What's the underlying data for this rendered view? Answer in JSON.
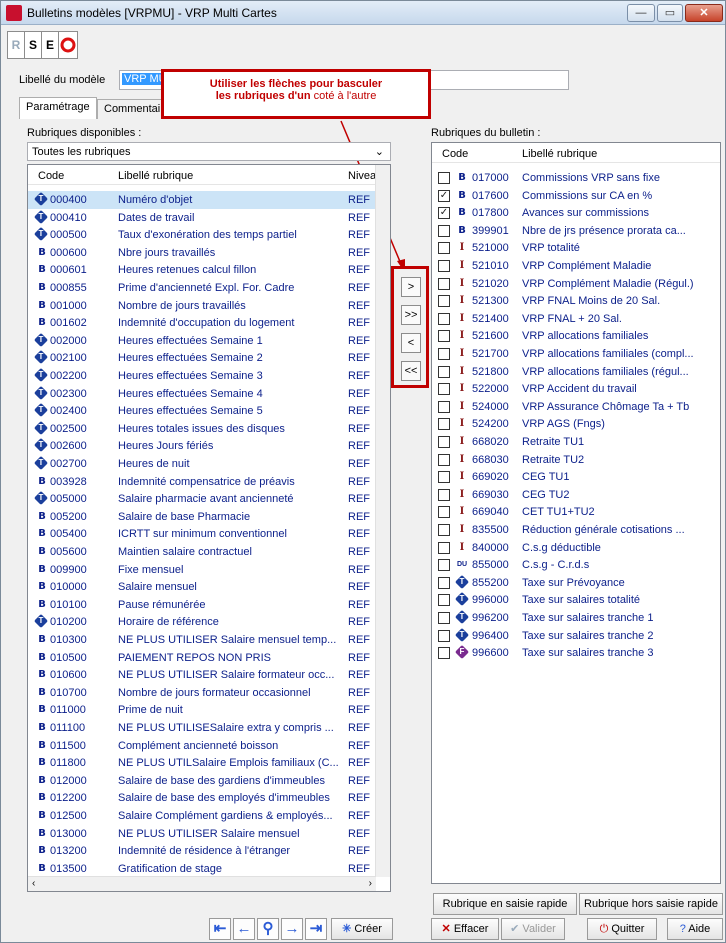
{
  "window": {
    "title": "Bulletins modèles [VRPMU] - VRP Multi Cartes",
    "controls": [
      "—",
      "▭",
      "✕"
    ]
  },
  "toolbar": {
    "r": "R",
    "s": "S",
    "e": "E"
  },
  "modele": {
    "label": "Libellé du modèle",
    "value": "VRP MU"
  },
  "tabs": [
    "Paramétrage",
    "Commentair"
  ],
  "callout": {
    "line1": "Utiliser les flèches pour basculer",
    "line2_bold": "les rubriques d'un",
    "line2_rest": "coté à l'autre"
  },
  "left": {
    "title": "Rubriques disponibles :",
    "dropdown": "Toutes les rubriques",
    "headers": {
      "code": "Code",
      "libelle": "Libellé rubrique",
      "niveau": "Nivea"
    },
    "rows": [
      {
        "icon": "T",
        "code": "000400",
        "libelle": "Numéro d'objet",
        "niveau": "REF",
        "selected": true
      },
      {
        "icon": "T",
        "code": "000410",
        "libelle": "Dates de travail",
        "niveau": "REF"
      },
      {
        "icon": "T",
        "code": "000500",
        "libelle": "Taux d'exonération des temps partiel",
        "niveau": "REF"
      },
      {
        "icon": "B",
        "code": "000600",
        "libelle": "Nbre jours travaillés",
        "niveau": "REF"
      },
      {
        "icon": "B",
        "code": "000601",
        "libelle": "Heures retenues calcul fillon",
        "niveau": "REF"
      },
      {
        "icon": "B",
        "code": "000855",
        "libelle": "Prime d'ancienneté Expl. For. Cadre",
        "niveau": "REF"
      },
      {
        "icon": "B",
        "code": "001000",
        "libelle": "Nombre de jours travaillés",
        "niveau": "REF"
      },
      {
        "icon": "B",
        "code": "001602",
        "libelle": "Indemnité d'occupation du logement",
        "niveau": "REF"
      },
      {
        "icon": "T",
        "code": "002000",
        "libelle": "Heures effectuées Semaine 1",
        "niveau": "REF"
      },
      {
        "icon": "T",
        "code": "002100",
        "libelle": "Heures effectuées Semaine 2",
        "niveau": "REF"
      },
      {
        "icon": "T",
        "code": "002200",
        "libelle": "Heures effectuées Semaine 3",
        "niveau": "REF"
      },
      {
        "icon": "T",
        "code": "002300",
        "libelle": "Heures effectuées Semaine 4",
        "niveau": "REF"
      },
      {
        "icon": "T",
        "code": "002400",
        "libelle": "Heures effectuées Semaine 5",
        "niveau": "REF"
      },
      {
        "icon": "T",
        "code": "002500",
        "libelle": "Heures totales issues des disques",
        "niveau": "REF"
      },
      {
        "icon": "T",
        "code": "002600",
        "libelle": "Heures Jours fériés",
        "niveau": "REF"
      },
      {
        "icon": "T",
        "code": "002700",
        "libelle": "Heures de nuit",
        "niveau": "REF"
      },
      {
        "icon": "B",
        "code": "003928",
        "libelle": "Indemnité compensatrice de préavis",
        "niveau": "REF"
      },
      {
        "icon": "T",
        "code": "005000",
        "libelle": "Salaire pharmacie avant ancienneté",
        "niveau": "REF"
      },
      {
        "icon": "B",
        "code": "005200",
        "libelle": "Salaire de base Pharmacie",
        "niveau": "REF"
      },
      {
        "icon": "B",
        "code": "005400",
        "libelle": "ICRTT sur minimum conventionnel",
        "niveau": "REF"
      },
      {
        "icon": "B",
        "code": "005600",
        "libelle": "Maintien salaire contractuel",
        "niveau": "REF"
      },
      {
        "icon": "B",
        "code": "009900",
        "libelle": "Fixe mensuel",
        "niveau": "REF"
      },
      {
        "icon": "B",
        "code": "010000",
        "libelle": "Salaire mensuel",
        "niveau": "REF"
      },
      {
        "icon": "B",
        "code": "010100",
        "libelle": "Pause rémunérée",
        "niveau": "REF"
      },
      {
        "icon": "T",
        "code": "010200",
        "libelle": "Horaire de référence",
        "niveau": "REF"
      },
      {
        "icon": "B",
        "code": "010300",
        "libelle": "NE PLUS UTILISER Salaire mensuel temp...",
        "niveau": "REF"
      },
      {
        "icon": "B",
        "code": "010500",
        "libelle": "PAIEMENT REPOS NON PRIS",
        "niveau": "REF"
      },
      {
        "icon": "B",
        "code": "010600",
        "libelle": "NE PLUS UTILISER Salaire formateur occ...",
        "niveau": "REF"
      },
      {
        "icon": "B",
        "code": "010700",
        "libelle": "Nombre de jours formateur occasionnel",
        "niveau": "REF"
      },
      {
        "icon": "B",
        "code": "011000",
        "libelle": "Prime de nuit",
        "niveau": "REF"
      },
      {
        "icon": "B",
        "code": "011100",
        "libelle": "NE PLUS UTILISESalaire extra y compris ...",
        "niveau": "REF"
      },
      {
        "icon": "B",
        "code": "011500",
        "libelle": "Complément ancienneté boisson",
        "niveau": "REF"
      },
      {
        "icon": "B",
        "code": "011800",
        "libelle": "NE PLUS UTILSalaire Emplois familiaux (C...",
        "niveau": "REF"
      },
      {
        "icon": "B",
        "code": "012000",
        "libelle": "Salaire de base des gardiens d'immeubles",
        "niveau": "REF"
      },
      {
        "icon": "B",
        "code": "012200",
        "libelle": "Salaire de base des employés d'immeubles",
        "niveau": "REF"
      },
      {
        "icon": "B",
        "code": "012500",
        "libelle": "Salaire Complément gardiens & employés...",
        "niveau": "REF"
      },
      {
        "icon": "B",
        "code": "013000",
        "libelle": "NE PLUS UTILISER Salaire mensuel",
        "niveau": "REF"
      },
      {
        "icon": "B",
        "code": "013200",
        "libelle": "Indemnité de résidence à l'étranger",
        "niveau": "REF"
      },
      {
        "icon": "B",
        "code": "013500",
        "libelle": "Gratification de stage",
        "niveau": "REF"
      }
    ]
  },
  "arrows": [
    ">",
    ">>",
    "<",
    "<<"
  ],
  "right": {
    "title": "Rubriques du bulletin :",
    "headers": {
      "code": "Code",
      "libelle": "Libellé rubrique"
    },
    "rows": [
      {
        "checked": false,
        "icon": "B",
        "code": "017000",
        "libelle": "Commissions VRP sans fixe"
      },
      {
        "checked": true,
        "icon": "B",
        "code": "017600",
        "libelle": "Commissions sur CA en %"
      },
      {
        "checked": true,
        "icon": "B",
        "code": "017800",
        "libelle": "Avances sur commissions"
      },
      {
        "checked": false,
        "icon": "B",
        "code": "399901",
        "libelle": "Nbre de jrs présence prorata ca..."
      },
      {
        "checked": false,
        "icon": "I",
        "code": "521000",
        "libelle": "VRP totalité"
      },
      {
        "checked": false,
        "icon": "I",
        "code": "521010",
        "libelle": "VRP Complément Maladie"
      },
      {
        "checked": false,
        "icon": "I",
        "code": "521020",
        "libelle": "VRP Complément Maladie (Régul.)"
      },
      {
        "checked": false,
        "icon": "I",
        "code": "521300",
        "libelle": "VRP FNAL Moins de 20 Sal."
      },
      {
        "checked": false,
        "icon": "I",
        "code": "521400",
        "libelle": "VRP FNAL + 20 Sal."
      },
      {
        "checked": false,
        "icon": "I",
        "code": "521600",
        "libelle": "VRP allocations familiales"
      },
      {
        "checked": false,
        "icon": "I",
        "code": "521700",
        "libelle": "VRP allocations familiales (compl..."
      },
      {
        "checked": false,
        "icon": "I",
        "code": "521800",
        "libelle": "VRP allocations familiales (régul..."
      },
      {
        "checked": false,
        "icon": "I",
        "code": "522000",
        "libelle": "VRP Accident du travail"
      },
      {
        "checked": false,
        "icon": "I",
        "code": "524000",
        "libelle": "VRP Assurance Chômage Ta + Tb"
      },
      {
        "checked": false,
        "icon": "I",
        "code": "524200",
        "libelle": "VRP AGS (Fngs)"
      },
      {
        "checked": false,
        "icon": "I",
        "code": "668020",
        "libelle": "Retraite TU1"
      },
      {
        "checked": false,
        "icon": "I",
        "code": "668030",
        "libelle": "Retraite TU2"
      },
      {
        "checked": false,
        "icon": "I",
        "code": "669020",
        "libelle": "CEG TU1"
      },
      {
        "checked": false,
        "icon": "I",
        "code": "669030",
        "libelle": "CEG TU2"
      },
      {
        "checked": false,
        "icon": "I",
        "code": "669040",
        "libelle": "CET TU1+TU2"
      },
      {
        "checked": false,
        "icon": "I",
        "code": "835500",
        "libelle": "Réduction générale cotisations ..."
      },
      {
        "checked": false,
        "icon": "I",
        "code": "840000",
        "libelle": "C.s.g déductible"
      },
      {
        "checked": false,
        "icon": "DU",
        "code": "855000",
        "libelle": "C.s.g - C.r.d.s"
      },
      {
        "checked": false,
        "icon": "T",
        "code": "855200",
        "libelle": "Taxe sur Prévoyance"
      },
      {
        "checked": false,
        "icon": "T",
        "code": "996000",
        "libelle": "Taxe sur salaires totalité"
      },
      {
        "checked": false,
        "icon": "T",
        "code": "996200",
        "libelle": "Taxe sur salaires tranche 1"
      },
      {
        "checked": false,
        "icon": "T",
        "code": "996400",
        "libelle": "Taxe sur salaires tranche 2"
      },
      {
        "checked": false,
        "icon": "F",
        "code": "996600",
        "libelle": "Taxe sur salaires tranche 3"
      }
    ],
    "btn_saisie_rapide": "Rubrique en saisie rapide",
    "btn_hors_saisie": "Rubrique hors saisie rapide"
  },
  "bottom": {
    "creer": "Créer",
    "effacer": "Effacer",
    "valider": "Valider",
    "quitter": "Quitter",
    "aide": "Aide"
  }
}
